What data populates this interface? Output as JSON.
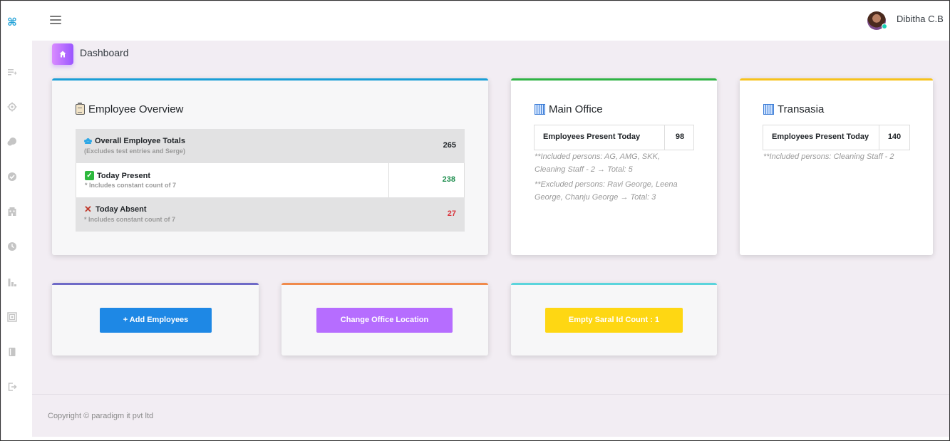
{
  "header": {
    "user_name": "Dibitha C.B"
  },
  "sidebar": {
    "logo": "⌘",
    "items": [
      {
        "icon": "playlist-add-icon"
      },
      {
        "icon": "target-icon"
      },
      {
        "icon": "chat-bubble-icon"
      },
      {
        "icon": "check-circle-icon"
      },
      {
        "icon": "building-icon"
      },
      {
        "icon": "clock-icon"
      },
      {
        "icon": "chart-icon"
      },
      {
        "icon": "image-icon"
      },
      {
        "icon": "book-icon"
      },
      {
        "icon": "logout-icon"
      }
    ]
  },
  "page": {
    "title": "Dashboard"
  },
  "overview": {
    "title": "Employee Overview",
    "rows": [
      {
        "label": "Overall Employee Totals",
        "sub": "(Excludes test entries and Serge)",
        "value": "265",
        "color": "#212529"
      },
      {
        "label": "Today Present",
        "sub": "* Includes constant count of 7",
        "value": "238",
        "color": "#1e8e4e"
      },
      {
        "label": "Today Absent",
        "sub": "* Includes constant count of 7",
        "value": "27",
        "color": "#d9363e"
      }
    ]
  },
  "main_office": {
    "title": "Main Office",
    "label": "Employees Present Today",
    "value": "98",
    "note1_line1": "**Included persons: AG, AMG, SKK,",
    "note1_line2": "Cleaning Staff - 2 → Total: 5",
    "note2_line1": "**Excluded persons: Ravi George, Leena",
    "note2_line2": "George, Chanju George → Total: 3"
  },
  "transasia": {
    "title": "Transasia",
    "label": "Employees Present Today",
    "value": "140",
    "note": "**Included persons: Cleaning Staff - 2"
  },
  "actions": {
    "add_employees": "+ Add Employees",
    "change_office": "Change Office Location",
    "empty_saral": "Empty Saral Id Count : 1"
  },
  "colors": {
    "accent_blue": "#1a9ed6",
    "green": "#2fb344",
    "yellow": "#f7c21b",
    "purple_top": "#6f6ac7",
    "orange_top": "#f08a4b",
    "teal_top": "#5bd4dc",
    "btn_blue": "#1e88e5",
    "btn_purple": "#b66dff",
    "btn_yellow": "#fed713"
  },
  "footer": {
    "copyright": "Copyright © paradigm it pvt ltd"
  }
}
